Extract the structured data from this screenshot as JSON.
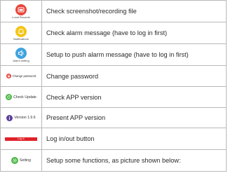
{
  "rows": [
    {
      "icon_label": "Local Records",
      "icon": "folder-record-icon",
      "color": "#e8463b",
      "description": "Check screenshot/recording file"
    },
    {
      "icon_label": "Notifications",
      "icon": "bell-icon",
      "color": "#f3c516",
      "description": "Check alarm message (have to log in first)"
    },
    {
      "icon_label": "Alarm setting",
      "icon": "speaker-icon",
      "color": "#3fa3e0",
      "description": "Setup to push alarm message (have to log in first)"
    },
    {
      "icon_label": "Change password",
      "icon": "lock-icon",
      "color": "#e8463b",
      "description": "Change password"
    },
    {
      "icon_label": "Check Update",
      "icon": "refresh-icon",
      "color": "#4db848",
      "description": "Check APP version"
    },
    {
      "icon_label": "Version 1.9.6",
      "icon": "info-icon",
      "color": "#5c3f97",
      "description": "Present APP version"
    },
    {
      "icon_label": "Log in",
      "icon": "login-bar",
      "color": "#e0222a",
      "description": "Log in/out button"
    },
    {
      "icon_label": "Setting",
      "icon": "gear-icon",
      "color": "#4db848",
      "description": "Setup some functions, as picture shown below:"
    }
  ]
}
